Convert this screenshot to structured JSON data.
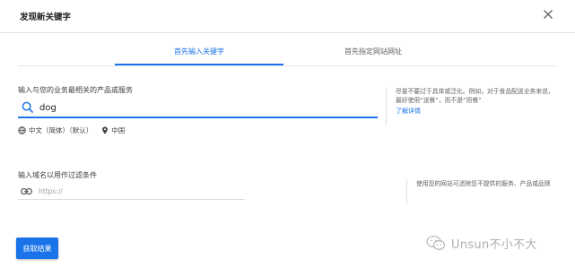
{
  "dialog": {
    "title": "发现新关键字"
  },
  "tabs": [
    {
      "label": "首先输入关键字",
      "active": true
    },
    {
      "label": "首先指定网站网址",
      "active": false
    }
  ],
  "keyword_section": {
    "label": "输入与您的业务最相关的产品或服务",
    "value": "dog",
    "language": "中文（简体）（默认）",
    "location": "中国",
    "tip": "尽量不要过于具体或泛化。例如，对于食品配送业务来说，最好使用“送餐”，而不是“用餐”",
    "learn_more": "了解详情"
  },
  "url_section": {
    "label": "输入域名以用作过滤条件",
    "placeholder": "https://",
    "tip": "使用您的网站可滤除您不提供的服务、产品或品牌"
  },
  "actions": {
    "get_results": "获取结果"
  },
  "watermark": {
    "text": "Unsun不小不大"
  },
  "colors": {
    "accent": "#1a73e8",
    "text": "#202124",
    "muted": "#5f6368"
  },
  "icons": {
    "close": "close-icon",
    "search": "search-icon",
    "language": "globe-icon",
    "location": "location-pin-icon",
    "url": "link-icon",
    "watermark": "wechat-icon"
  }
}
